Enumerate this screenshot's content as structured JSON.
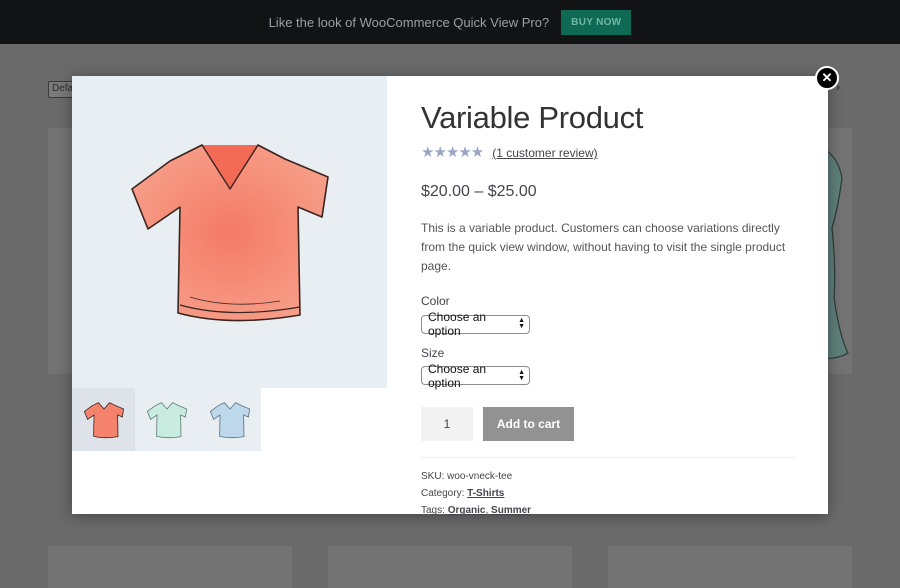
{
  "topbar": {
    "text": "Like the look of WooCommerce Quick View Pro?",
    "buy_label": "BUY NOW"
  },
  "background": {
    "sort_select_value": "Defa"
  },
  "modal": {
    "close_label": "✕",
    "product": {
      "title": "Variable Product",
      "rating": 5,
      "rating_max": 5,
      "review_link": "(1 customer review)",
      "price": "$20.00 – $25.00",
      "description": "This is a variable product. Customers can choose variations directly from the quick view window, without having to visit the single product page.",
      "variations": [
        {
          "label": "Color",
          "selected": "Choose an option"
        },
        {
          "label": "Size",
          "selected": "Choose an option"
        }
      ],
      "quantity": "1",
      "add_to_cart_label": "Add to cart",
      "meta": {
        "sku_label": "SKU:",
        "sku": "woo-vneck-tee",
        "category_label": "Category:",
        "category": "T-Shirts",
        "tags_label": "Tags:",
        "tags": [
          "Organic",
          "Summer"
        ],
        "tag_separator": ","
      },
      "thumbnails": [
        {
          "icon": "tshirt-coral-icon",
          "color": "#f4826c"
        },
        {
          "icon": "tshirt-mint-icon",
          "color": "#c9ece0"
        },
        {
          "icon": "tshirt-blue-icon",
          "color": "#bcd8ea"
        }
      ]
    }
  }
}
